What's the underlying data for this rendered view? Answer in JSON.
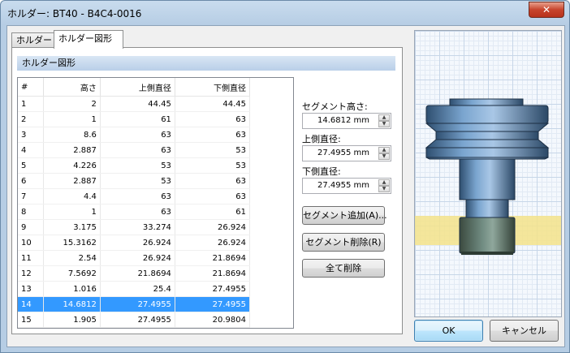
{
  "window": {
    "title": "ホルダー: BT40 - B4C4-0016",
    "close_glyph": "✕"
  },
  "tabs": [
    {
      "label": "ホルダー"
    },
    {
      "label": "ホルダー図形"
    }
  ],
  "section": {
    "title": "ホルダー図形"
  },
  "table": {
    "headers": [
      "#",
      "高さ",
      "上側直径",
      "下側直径"
    ],
    "rows": [
      [
        "1",
        "2",
        "44.45",
        "44.45"
      ],
      [
        "2",
        "1",
        "61",
        "63"
      ],
      [
        "3",
        "8.6",
        "63",
        "63"
      ],
      [
        "4",
        "2.887",
        "63",
        "53"
      ],
      [
        "5",
        "4.226",
        "53",
        "53"
      ],
      [
        "6",
        "2.887",
        "53",
        "63"
      ],
      [
        "7",
        "4.4",
        "63",
        "63"
      ],
      [
        "8",
        "1",
        "63",
        "61"
      ],
      [
        "9",
        "3.175",
        "33.274",
        "26.924"
      ],
      [
        "10",
        "15.3162",
        "26.924",
        "26.924"
      ],
      [
        "11",
        "2.54",
        "26.924",
        "21.8694"
      ],
      [
        "12",
        "7.5692",
        "21.8694",
        "21.8694"
      ],
      [
        "13",
        "1.016",
        "25.4",
        "27.4955"
      ],
      [
        "14",
        "14.6812",
        "27.4955",
        "27.4955"
      ],
      [
        "15",
        "1.905",
        "27.4955",
        "20.9804"
      ]
    ],
    "selected_row": "14"
  },
  "fields": {
    "segment_height": {
      "label": "セグメント高さ:",
      "value": "14.6812 mm"
    },
    "upper_diameter": {
      "label": "上側直径:",
      "value": "27.4955 mm"
    },
    "lower_diameter": {
      "label": "下側直径:",
      "value": "27.4955 mm"
    }
  },
  "buttons": {
    "add_segment": "セグメント追加(A)...",
    "delete_segment": "セグメント削除(R)",
    "delete_all": "全て削除",
    "ok": "OK",
    "cancel": "キャンセル"
  },
  "preview": {
    "highlight_color": "#f3e38a",
    "body_color": "#5a86b0"
  }
}
